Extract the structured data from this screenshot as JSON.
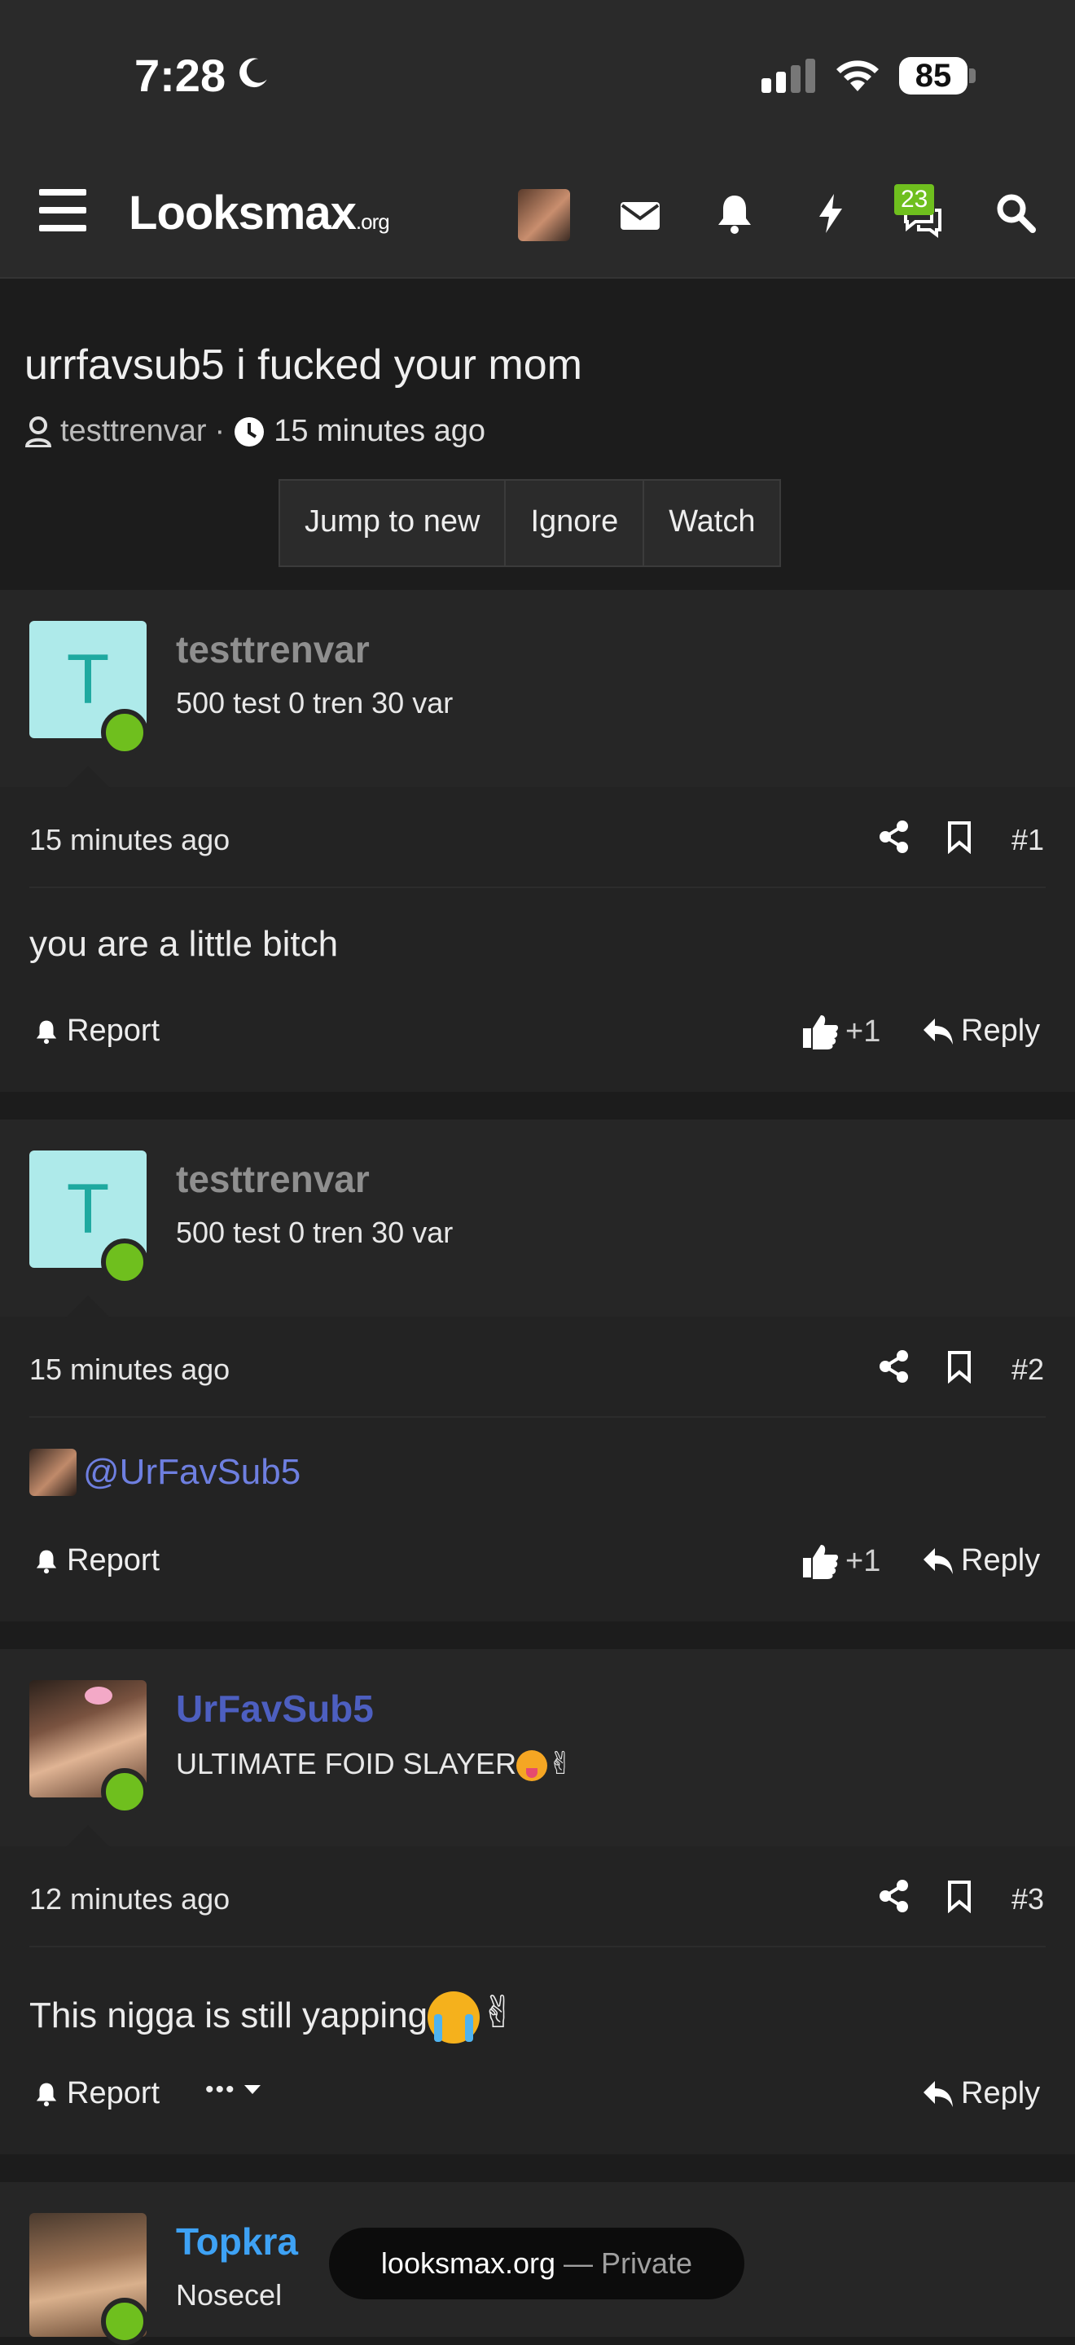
{
  "status": {
    "time": "7:28",
    "battery": "85"
  },
  "nav": {
    "logo_main": "Lksmax",
    "logo_oo": "oo",
    "logo_domain": ".org",
    "badge_count": "23"
  },
  "thread": {
    "title": "urrfavsub5 i fucked your mom",
    "author": "testtrenvar",
    "time": "15 minutes ago",
    "buttons": [
      "Jump to new",
      "Ignore",
      "Watch"
    ]
  },
  "posts": [
    {
      "avatar_letter": "T",
      "username": "testtrenvar",
      "user_title": "500 test 0 tren 30 var",
      "time": "15 minutes ago",
      "number": "#1",
      "body": "you are a little bitch",
      "report": "Report",
      "likes": "+1",
      "reply": "Reply"
    },
    {
      "avatar_letter": "T",
      "username": "testtrenvar",
      "user_title": "500 test 0 tren 30 var",
      "time": "15 minutes ago",
      "number": "#2",
      "mention": "@UrFavSub5",
      "report": "Report",
      "likes": "+1",
      "reply": "Reply"
    },
    {
      "username": "UrFavSub5",
      "user_title": "ULTIMATE FOID SLAYER",
      "time": "12 minutes ago",
      "number": "#3",
      "body": "This nigga is still yapping",
      "report": "Report",
      "more": "•••",
      "reply": "Reply"
    },
    {
      "username": "Topkra",
      "user_title": "Nosecel"
    }
  ],
  "toast": {
    "site": "looksmax.org",
    "suffix": " — Private"
  },
  "colors": {
    "online": "#6fbf1e",
    "mention": "#6e7fe0",
    "username_blue": "#4d5fc0",
    "username_sky": "#3ea2f5"
  }
}
